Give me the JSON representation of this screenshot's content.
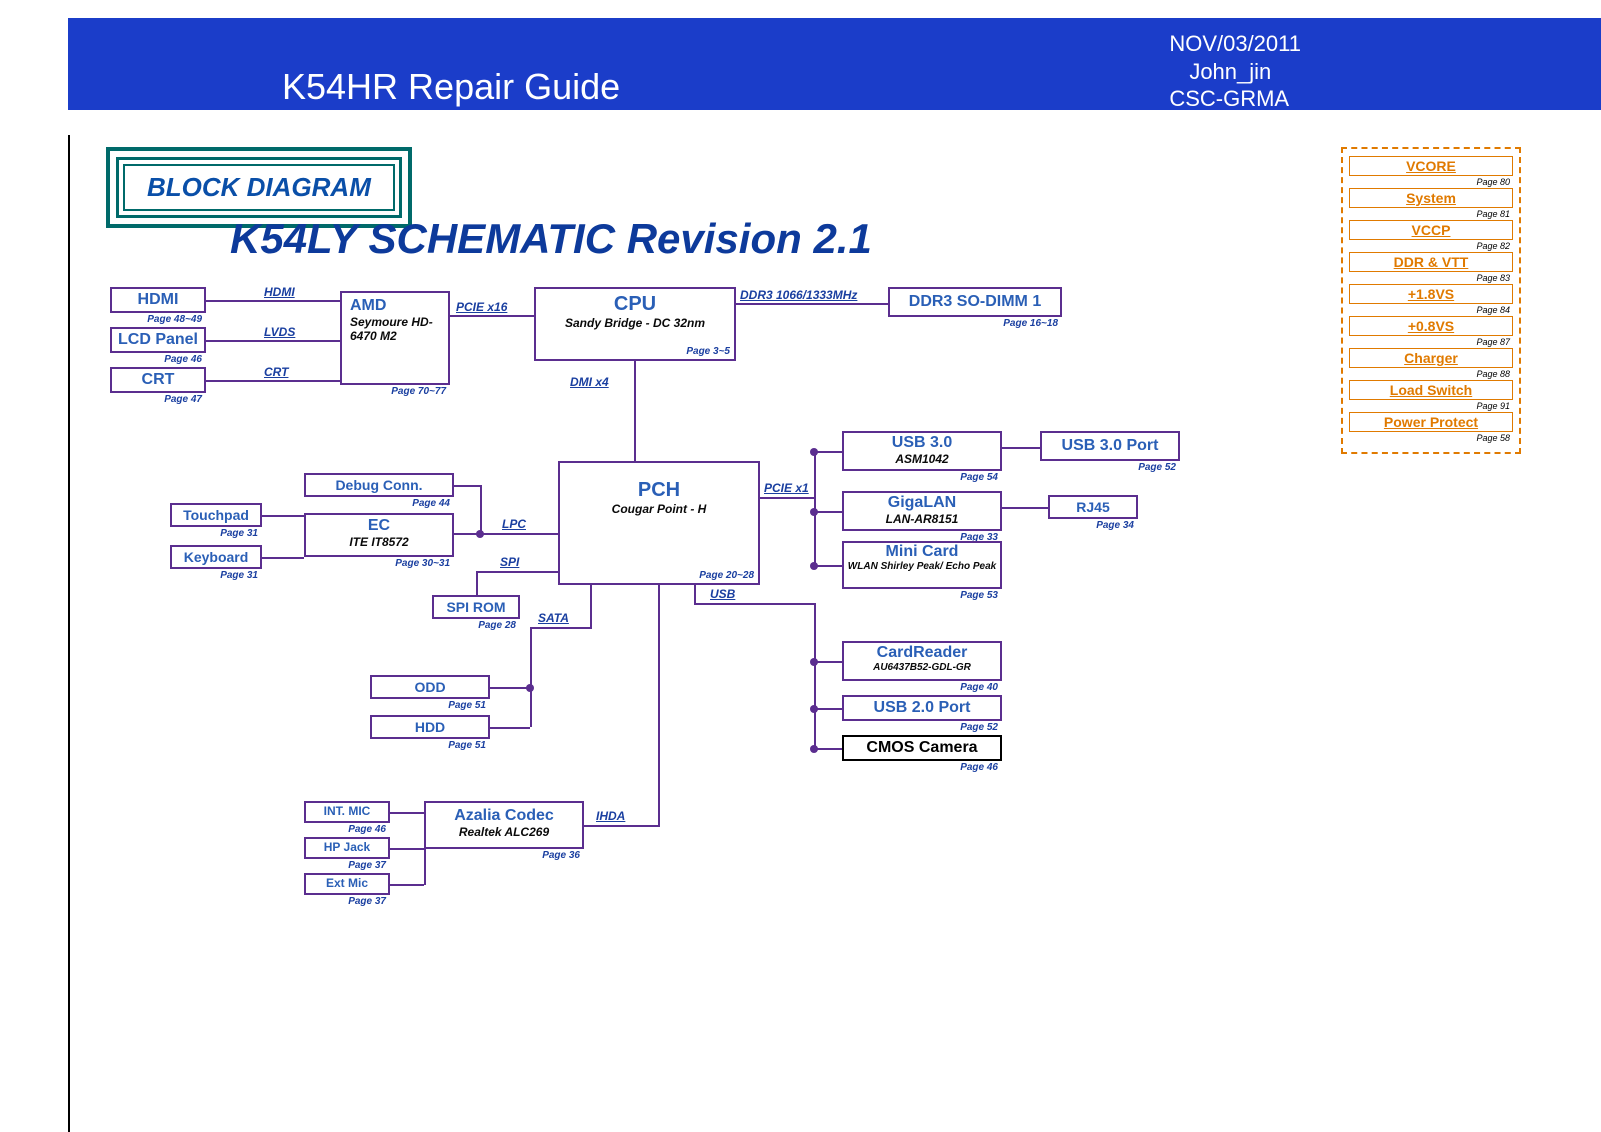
{
  "header": {
    "title": "K54HR Repair Guide",
    "date": "NOV/03/2011",
    "author": "John_jin",
    "dept": "CSC-GRMA"
  },
  "bd_label": "BLOCK DIAGRAM",
  "schematic_title": "K54LY SCHEMATIC Revision 2.1",
  "blocks": {
    "hdmi": {
      "t": "HDMI",
      "pg": "Page 48~49"
    },
    "lcd": {
      "t": "LCD Panel",
      "pg": "Page 46"
    },
    "crt": {
      "t": "CRT",
      "pg": "Page 47"
    },
    "amd": {
      "t": "AMD",
      "s": "Seymoure HD-6470 M2",
      "pg": "Page 70~77"
    },
    "cpu": {
      "t": "CPU",
      "s": "Sandy Bridge - DC 32nm",
      "pg": "Page 3~5"
    },
    "ddr": {
      "t": "DDR3 SO-DIMM 1",
      "pg": "Page 16~18"
    },
    "tp": {
      "t": "Touchpad",
      "pg": "Page 31"
    },
    "kb": {
      "t": "Keyboard",
      "pg": "Page 31"
    },
    "debug": {
      "t": "Debug Conn.",
      "pg": "Page 44"
    },
    "ec": {
      "t": "EC",
      "s": "ITE IT8572",
      "pg": "Page 30~31"
    },
    "pch": {
      "t": "PCH",
      "s": "Cougar Point - H",
      "pg": "Page 20~28"
    },
    "spi": {
      "t": "SPI ROM",
      "pg": "Page 28"
    },
    "odd": {
      "t": "ODD",
      "pg": "Page 51"
    },
    "hdd": {
      "t": "HDD",
      "pg": "Page 51"
    },
    "intmic": {
      "t": "INT. MIC",
      "pg": "Page 46"
    },
    "hpj": {
      "t": "HP Jack",
      "pg": "Page 37"
    },
    "extmic": {
      "t": "Ext Mic",
      "pg": "Page 37"
    },
    "azalia": {
      "t": "Azalia Codec",
      "s": "Realtek ALC269",
      "pg": "Page 36"
    },
    "usb3": {
      "t": "USB 3.0",
      "s": "ASM1042",
      "pg": "Page 54"
    },
    "usb3p": {
      "t": "USB 3.0 Port",
      "pg": "Page 52"
    },
    "giga": {
      "t": "GigaLAN",
      "s": "LAN-AR8151",
      "pg": "Page 33"
    },
    "rj45": {
      "t": "RJ45",
      "pg": "Page 34"
    },
    "mini": {
      "t": "Mini Card",
      "s": "WLAN Shirley Peak/ Echo Peak",
      "pg": "Page 53"
    },
    "cr": {
      "t": "CardReader",
      "s": "AU6437B52-GDL-GR",
      "pg": "Page 40"
    },
    "usb2p": {
      "t": "USB 2.0 Port",
      "pg": "Page 52"
    },
    "cmos": {
      "t": "CMOS Camera",
      "pg": "Page 46"
    }
  },
  "buses": {
    "hdmi": "HDMI",
    "lvds": "LVDS",
    "crtb": "CRT",
    "pcie16": "PCIE x16",
    "dmi": "DMI x4",
    "ddr3": "DDR3 1066/1333MHz",
    "lpc": "LPC",
    "spi": "SPI",
    "sata": "SATA",
    "ihda": "IHDA",
    "pcie1": "PCIE x1",
    "usb": "USB"
  },
  "rails": [
    {
      "t": "VCORE",
      "pg": "Page 80"
    },
    {
      "t": "System",
      "pg": "Page 81"
    },
    {
      "t": "VCCP",
      "pg": "Page 82"
    },
    {
      "t": "DDR & VTT",
      "pg": "Page 83"
    },
    {
      "t": "+1.8VS",
      "pg": "Page 84"
    },
    {
      "t": "+0.8VS",
      "pg": "Page 87"
    },
    {
      "t": "Charger",
      "pg": "Page 88"
    },
    {
      "t": "Load Switch",
      "pg": "Page 91"
    },
    {
      "t": "Power Protect",
      "pg": "Page 58"
    }
  ]
}
